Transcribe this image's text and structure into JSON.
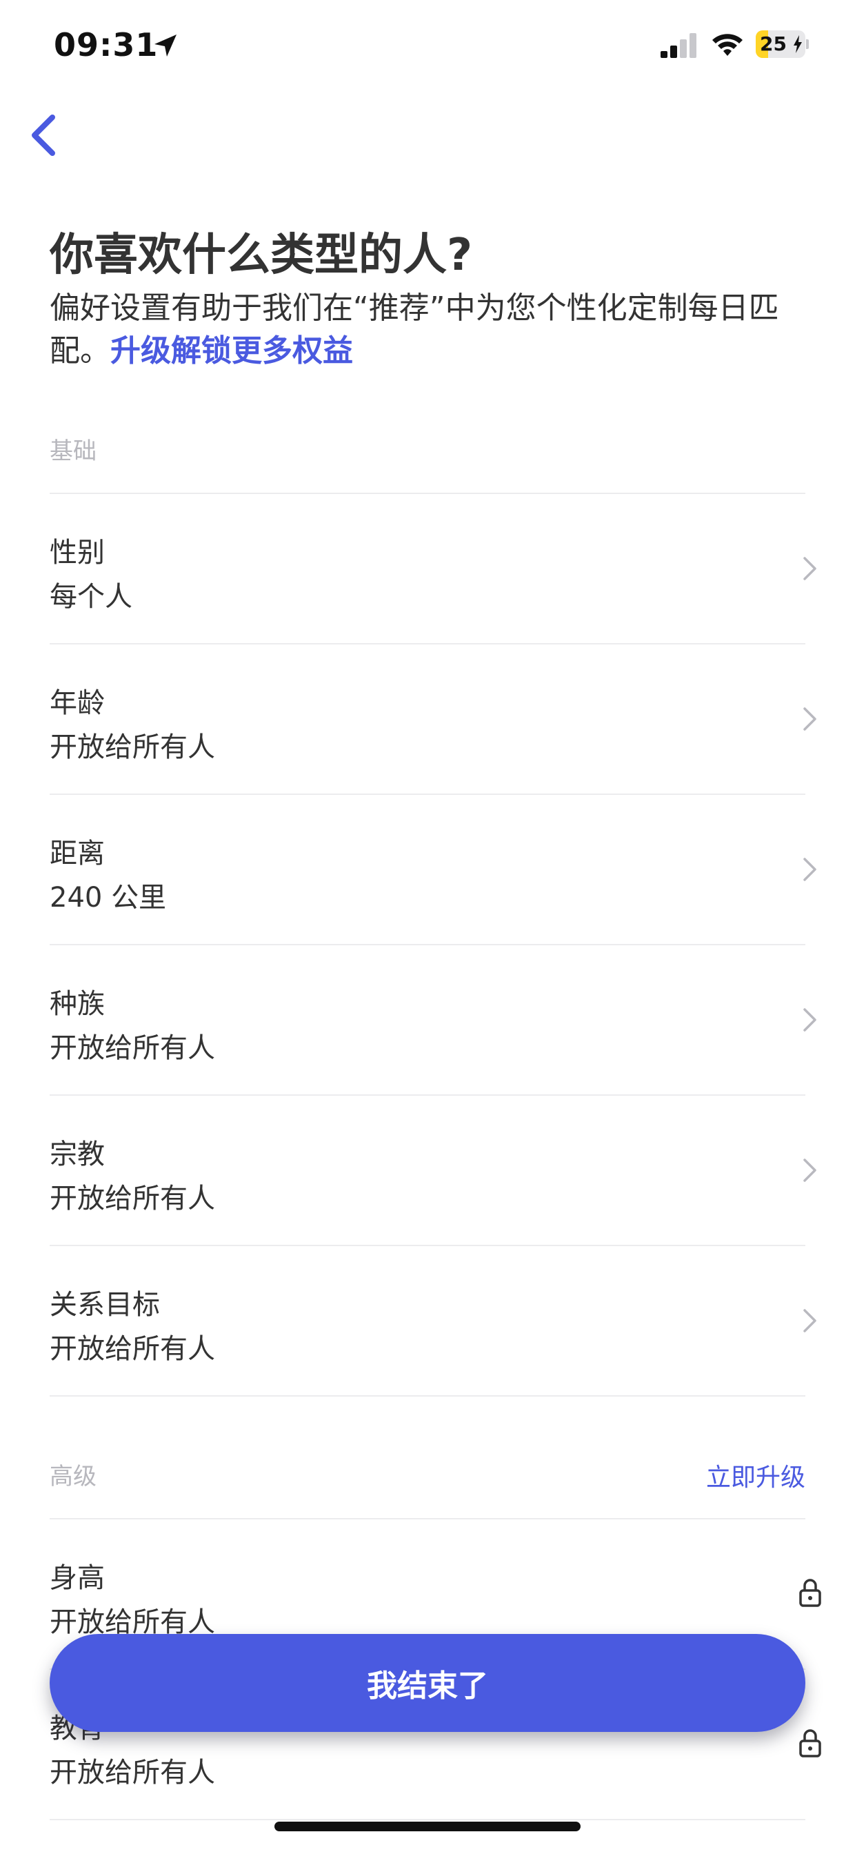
{
  "status_bar": {
    "time": "09:31",
    "battery_level": "25",
    "battery_fraction": 0.25,
    "icons": [
      "location-arrow-icon",
      "cellular-signal-icon",
      "wifi-icon",
      "battery-charging-icon"
    ]
  },
  "header": {
    "back_icon": "chevron-left-icon",
    "title": "你喜欢什么类型的人?",
    "subtitle": "偏好设置有助于我们在“推荐”中为您个性化定制每日匹配。",
    "upgrade_link": "升级解锁更多权益"
  },
  "basic_section": {
    "title": "基础",
    "items": [
      {
        "label": "性别",
        "value": "每个人"
      },
      {
        "label": "年龄",
        "value": "开放给所有人"
      },
      {
        "label": "距离",
        "value": "240 公里"
      },
      {
        "label": "种族",
        "value": "开放给所有人"
      },
      {
        "label": "宗教",
        "value": "开放给所有人"
      },
      {
        "label": "关系目标",
        "value": "开放给所有人"
      }
    ]
  },
  "advanced_section": {
    "title": "高级",
    "action": "立即升级",
    "items": [
      {
        "label": "身高",
        "value": "开放给所有人",
        "locked": true
      },
      {
        "label": "教育",
        "value": "开放给所有人",
        "locked": true
      }
    ]
  },
  "footer": {
    "done_button": "我结束了"
  },
  "colors": {
    "accent": "#4a5ae0",
    "text": "#333333",
    "section_title": "#b7b7bd",
    "divider": "#ececee",
    "battery": "#ffd426"
  }
}
